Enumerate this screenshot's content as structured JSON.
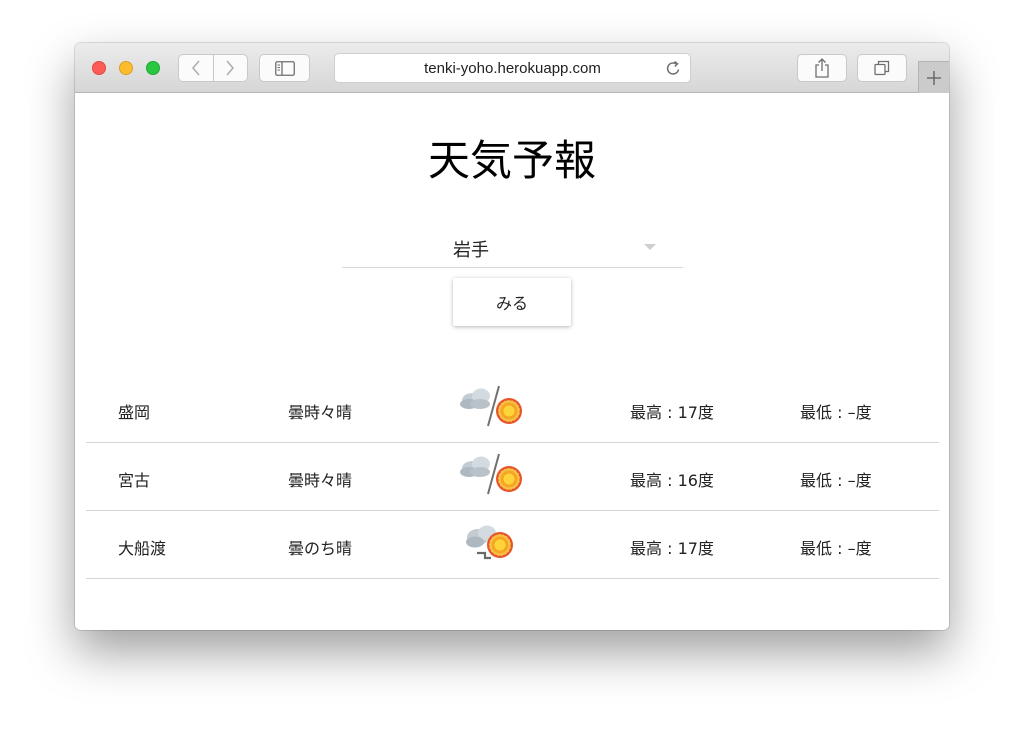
{
  "browser": {
    "url": "tenki-yoho.herokuapp.com"
  },
  "page": {
    "title": "天気予報",
    "prefecture_select": {
      "selected": "岩手"
    },
    "view_button_label": "みる"
  },
  "forecast": [
    {
      "city": "盛岡",
      "description": "曇時々晴",
      "icon": "cloudy-sometimes-sunny-icon",
      "max": "最高 : 17度",
      "min": "最低 : –度"
    },
    {
      "city": "宮古",
      "description": "曇時々晴",
      "icon": "cloudy-sometimes-sunny-icon",
      "max": "最高 : 16度",
      "min": "最低 : –度"
    },
    {
      "city": "大船渡",
      "description": "曇のち晴",
      "icon": "cloudy-then-sunny-icon",
      "max": "最高 : 17度",
      "min": "最低 : –度"
    }
  ],
  "colors": {
    "close": "#fd5c56",
    "minimize": "#fdbb2e",
    "maximize": "#28c840",
    "sun": "#f5a623",
    "sun_edge": "#e8542a",
    "cloud": "#b9c2c9"
  }
}
